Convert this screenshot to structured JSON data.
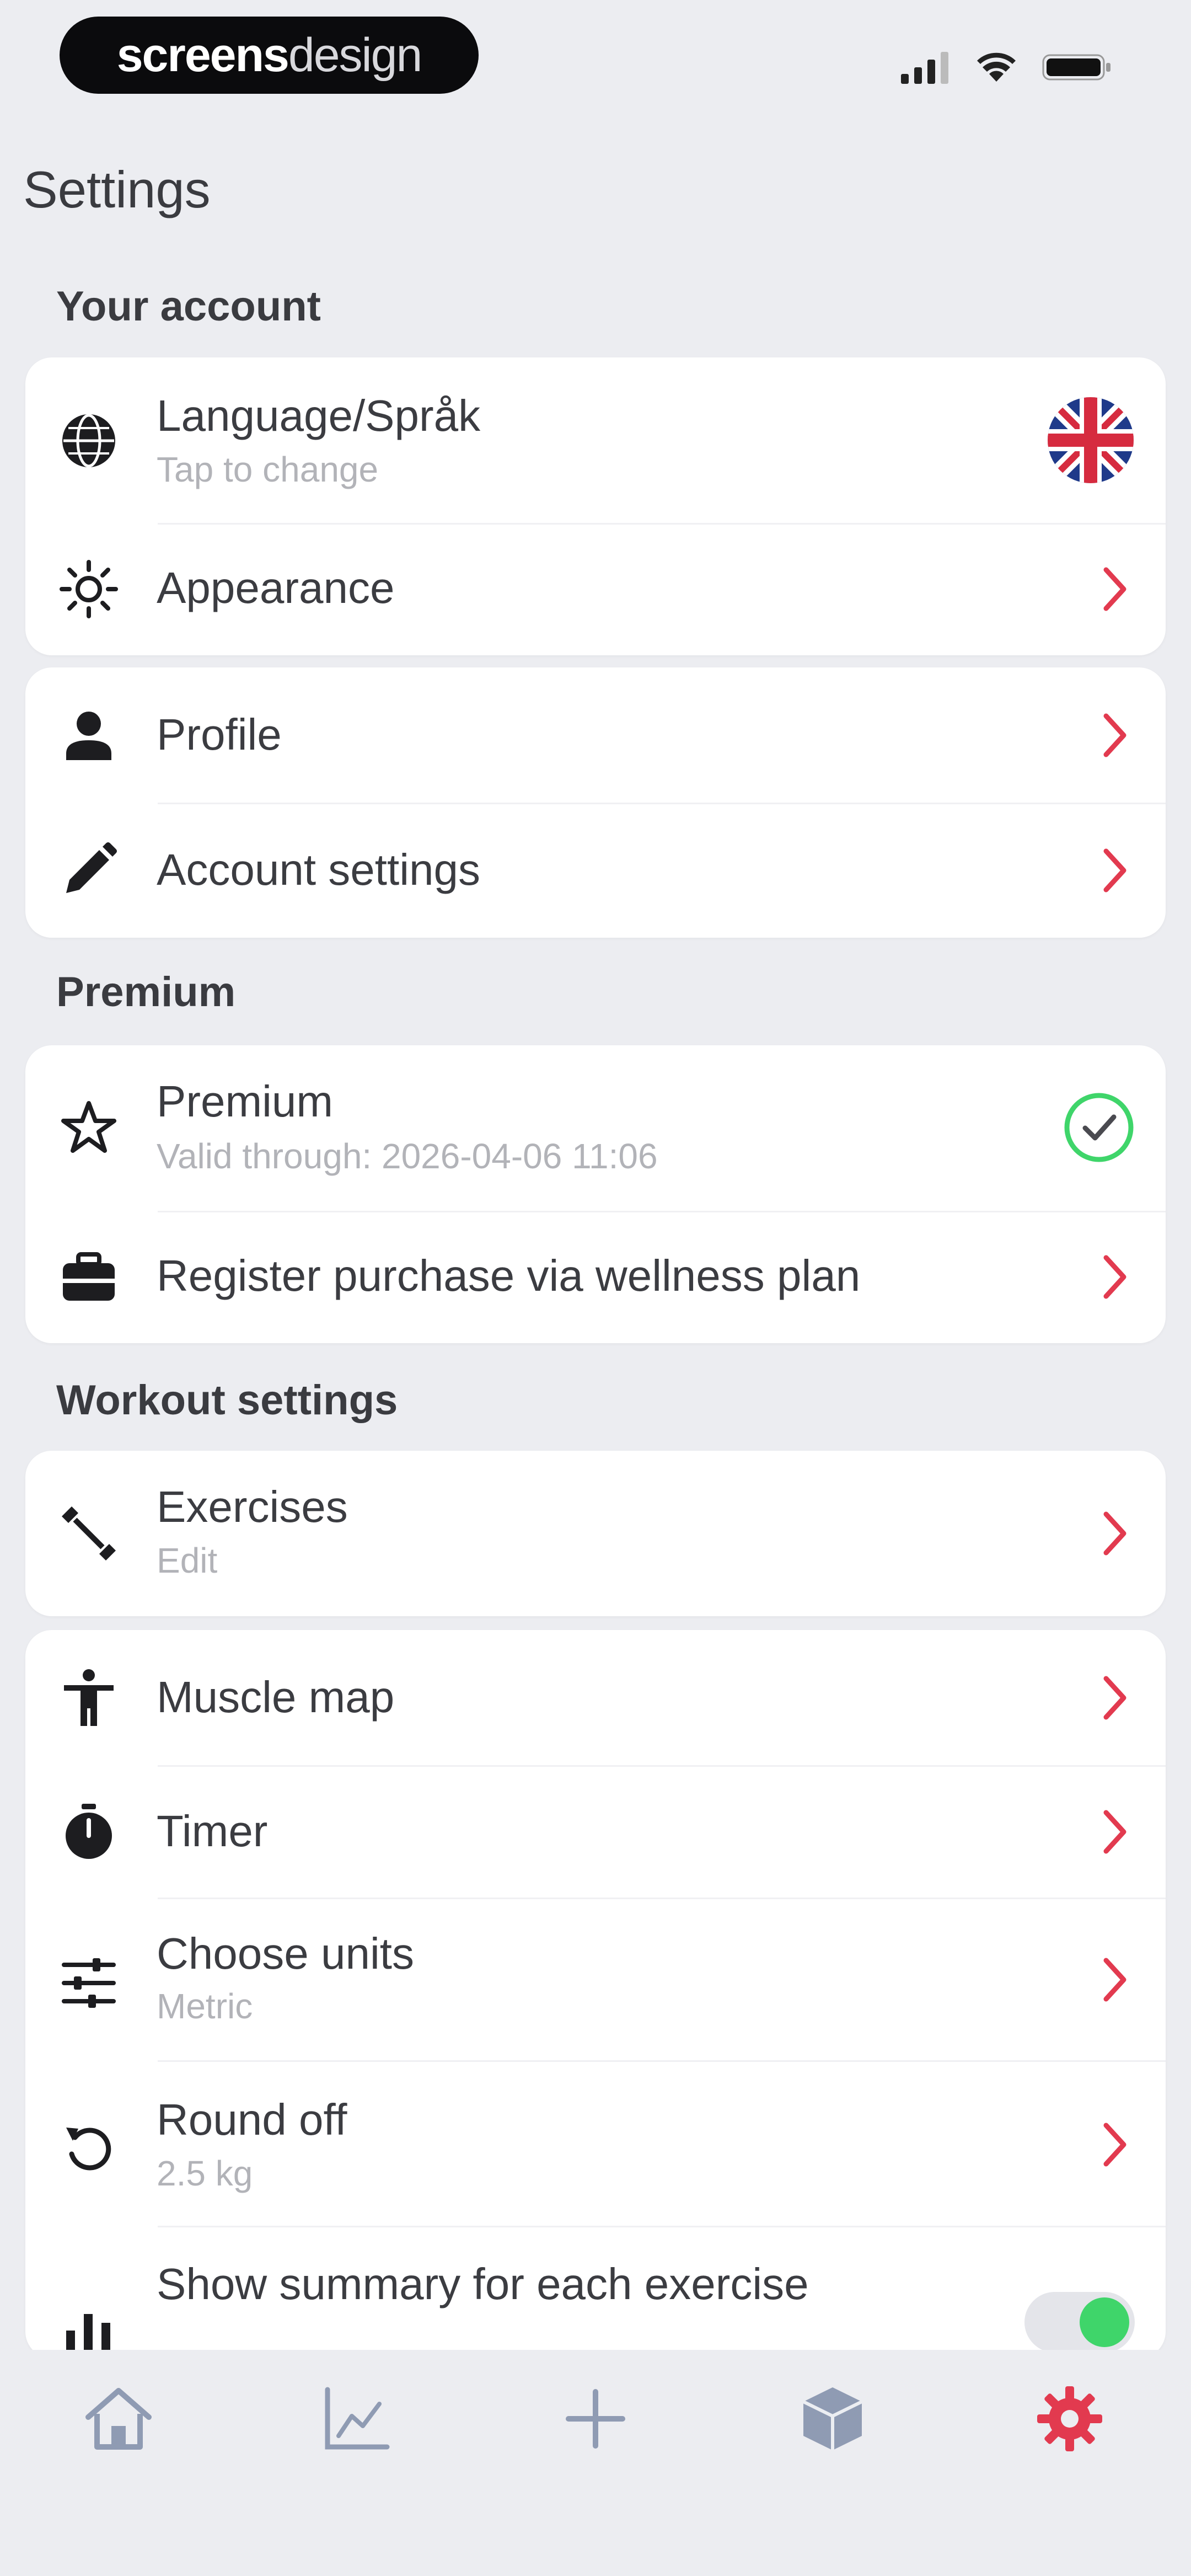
{
  "status_bar": {
    "brand_bold": "screens",
    "brand_light": "design"
  },
  "page_title": "Settings",
  "sections": {
    "account": "Your account",
    "premium": "Premium",
    "workout": "Workout settings"
  },
  "rows": {
    "language": {
      "title": "Language/Språk",
      "sub": "Tap to change"
    },
    "appearance": {
      "title": "Appearance"
    },
    "profile": {
      "title": "Profile"
    },
    "account_settings": {
      "title": "Account settings"
    },
    "premium": {
      "title": "Premium",
      "sub": "Valid through: 2026-04-06 11:06"
    },
    "wellness": {
      "title": "Register purchase via wellness plan"
    },
    "exercises": {
      "title": "Exercises",
      "sub": "Edit"
    },
    "muscle_map": {
      "title": "Muscle map"
    },
    "timer": {
      "title": "Timer"
    },
    "units": {
      "title": "Choose units",
      "sub": "Metric"
    },
    "round_off": {
      "title": "Round off",
      "sub": "2.5 kg"
    },
    "summary": {
      "title": "Show summary for each exercise"
    }
  },
  "tabs": [
    "home",
    "statistics",
    "add",
    "workouts",
    "settings"
  ],
  "colors": {
    "accent": "#e23a4f",
    "success": "#3fd56a",
    "icon": "#1d1d20",
    "tab_inactive": "#8f9bb3"
  }
}
